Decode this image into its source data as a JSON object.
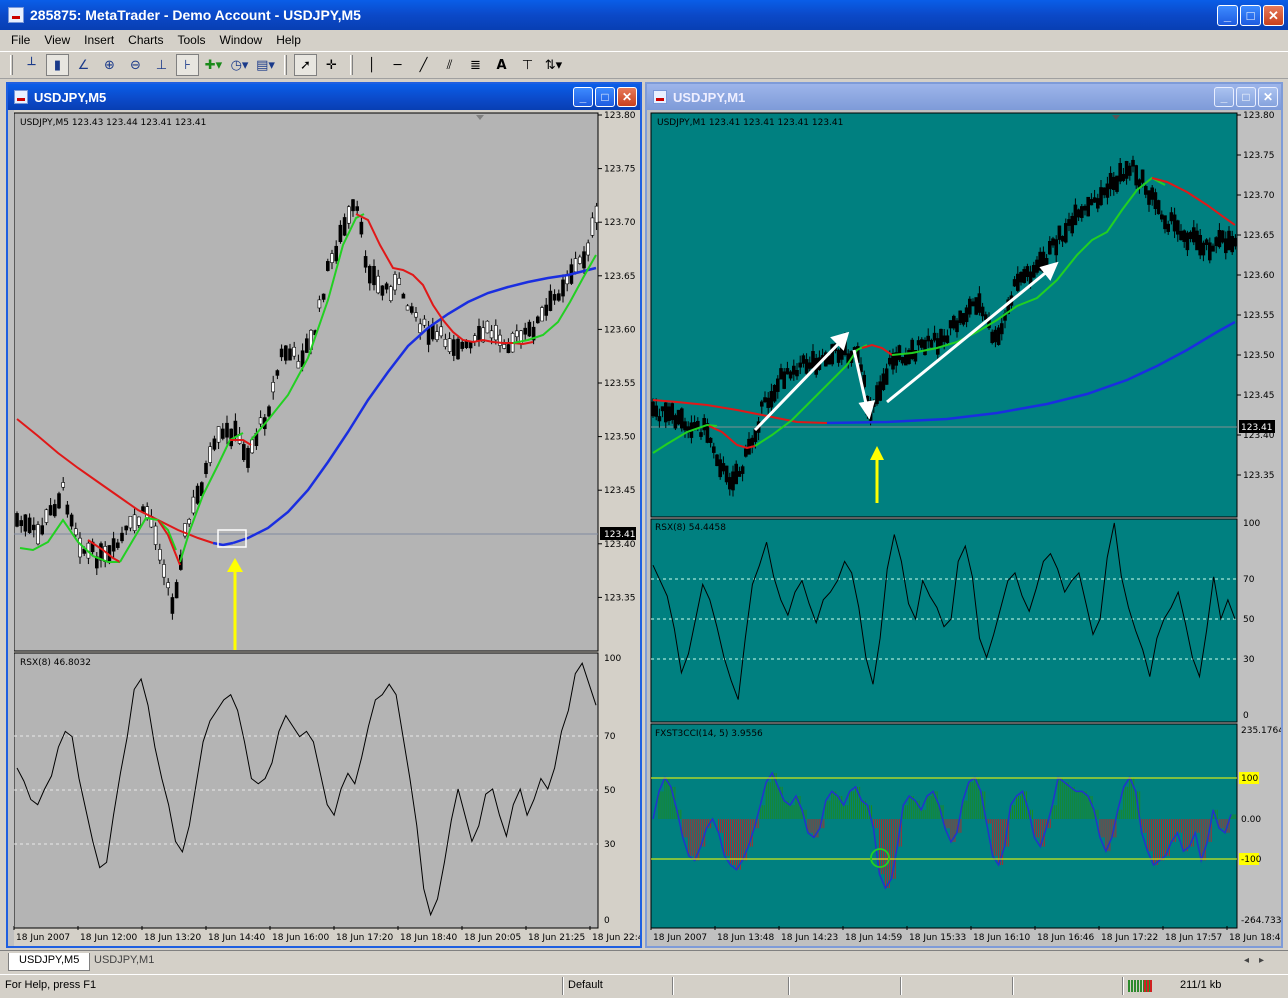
{
  "window": {
    "title": "285875: MetaTrader - Demo Account - USDJPY,M5",
    "min": "_",
    "max": "□",
    "close": "✕"
  },
  "menu": [
    "File",
    "View",
    "Insert",
    "Charts",
    "Tools",
    "Window",
    "Help"
  ],
  "toolbar": {
    "icons": [
      "bar-chart-icon",
      "candlestick-icon",
      "line-chart-icon",
      "zoom-in-icon",
      "zoom-out-icon",
      "chart-shift-icon",
      "autoscroll-icon",
      "indicators-icon",
      "periods-icon",
      "templates-icon",
      "cursor-icon",
      "crosshair-icon",
      "vertical-line-icon",
      "horizontal-line-icon",
      "trendline-icon",
      "equidistant-channel-icon",
      "fibonacci-icon",
      "text-icon",
      "text-label-icon",
      "arrows-icon"
    ],
    "text_tool": "A"
  },
  "left_chart": {
    "window_title": "USDJPY,M5",
    "header": "USDJPY,M5  123.43 123.44 123.41 123.41",
    "price_ticks": [
      "123.80",
      "123.75",
      "123.70",
      "123.65",
      "123.60",
      "123.55",
      "123.50",
      "123.45",
      "123.40",
      "123.35"
    ],
    "current_price": "123.41",
    "rsx_label": "RSX(8) 46.8032",
    "rsx_ticks": [
      "100",
      "70",
      "50",
      "30",
      "0"
    ],
    "time_ticks": [
      "18 Jun 2007",
      "18 Jun 12:00",
      "18 Jun 13:20",
      "18 Jun 14:40",
      "18 Jun 16:00",
      "18 Jun 17:20",
      "18 Jun 18:40",
      "18 Jun 20:05",
      "18 Jun 21:25",
      "18 Jun 22:4"
    ],
    "colors": {
      "background": "#b4b4b4",
      "ma_slow": "#1a2ee0",
      "ma_up": "#22d022",
      "ma_down": "#e01818",
      "arrow": "#ffff00"
    }
  },
  "right_chart": {
    "window_title": "USDJPY,M1",
    "header": "USDJPY,M1  123.41 123.41 123.41 123.41",
    "price_ticks": [
      "123.80",
      "123.75",
      "123.70",
      "123.65",
      "123.60",
      "123.55",
      "123.50",
      "123.45",
      "123.40",
      "123.35"
    ],
    "current_price": "123.41",
    "rsx_label": "RSX(8) 54.4458",
    "rsx_ticks": [
      "100",
      "70",
      "50",
      "30",
      "0"
    ],
    "cci_label": "FXST3CCI(14, 5) 3.9556",
    "cci_ticks": [
      "235.1764",
      "100",
      "0.00",
      "-100",
      "-264.733"
    ],
    "time_ticks": [
      "18 Jun 2007",
      "18 Jun 13:48",
      "18 Jun 14:23",
      "18 Jun 14:59",
      "18 Jun 15:33",
      "18 Jun 16:10",
      "18 Jun 16:46",
      "18 Jun 17:22",
      "18 Jun 17:57",
      "18 Jun 18:4"
    ],
    "colors": {
      "background": "#008080",
      "ma_slow": "#1a2ee0",
      "ma_up": "#22d022",
      "ma_down": "#e01818",
      "cci_pos": "#1d8a1d",
      "cci_neg": "#a33030",
      "level": "#ffff00"
    }
  },
  "tabs": [
    "USDJPY,M5",
    "USDJPY,M1"
  ],
  "status": {
    "help": "For Help, press F1",
    "profile": "Default",
    "traffic": "211/1 kb"
  }
}
